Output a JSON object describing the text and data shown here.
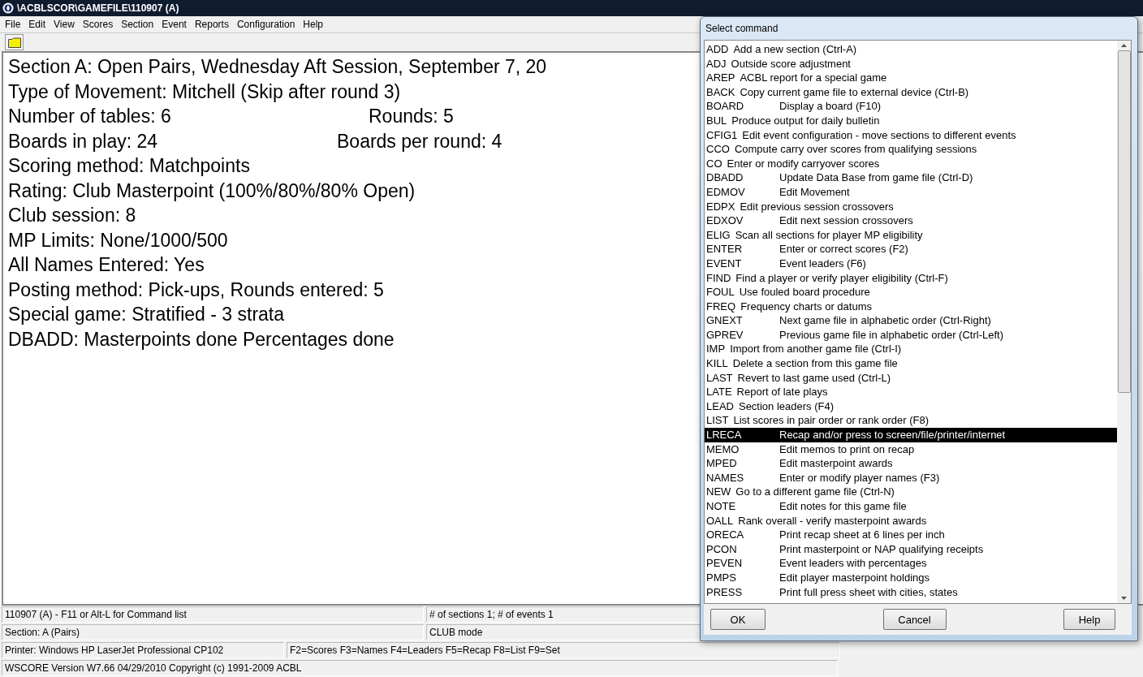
{
  "window": {
    "title": "\\ACBLSCOR\\GAMEFILE\\110907 (A)"
  },
  "menu": [
    "File",
    "Edit",
    "View",
    "Scores",
    "Section",
    "Event",
    "Reports",
    "Configuration",
    "Help"
  ],
  "summary_lines": [
    "Section A: Open Pairs, Wednesday Aft Session, September 7, 20",
    "Type of Movement: Mitchell (Skip after round 3)",
    [
      "Number of tables: 6",
      "Rounds: 5"
    ],
    [
      "Boards in play: 24",
      "Boards per round: 4"
    ],
    "Scoring method: Matchpoints",
    "Rating: Club Masterpoint (100%/80%/80% Open)",
    "Club session: 8",
    "MP Limits: None/1000/500",
    "All Names Entered: Yes",
    "Posting method: Pick-ups, Rounds entered: 5",
    "Special game:  Stratified - 3 strata",
    "DBADD: Masterpoints done  Percentages done"
  ],
  "status_bar": [
    [
      "110907 (A)  -  F11 or Alt-L for Command list",
      "# of sections 1; # of events 1"
    ],
    [
      "Section: A (Pairs)",
      "CLUB mode"
    ],
    [
      "Printer: Windows HP LaserJet Professional CP102",
      "F2=Scores F3=Names F4=Leaders F5=Recap F8=List F9=Set"
    ],
    [
      "WSCORE Version W7.66 04/29/2010  Copyright (c) 1991-2009 ACBL"
    ]
  ],
  "dialog": {
    "title": "Select command",
    "buttons": [
      "OK",
      "Cancel",
      "Help"
    ],
    "commands": [
      {
        "code": "ADD",
        "description": "Add a new section (Ctrl-A)",
        "kind": "inline",
        "selected": false
      },
      {
        "code": "ADJ",
        "description": "Outside score adjustment",
        "kind": "inline",
        "selected": false
      },
      {
        "code": "AREP",
        "description": "ACBL report for a special game",
        "kind": "inline",
        "selected": false
      },
      {
        "code": "BACK",
        "description": "Copy current game file to external device (Ctrl-B)",
        "kind": "inline",
        "selected": false
      },
      {
        "code": "BOARD",
        "description": "Display a board (F10)",
        "kind": "tabbed",
        "selected": false
      },
      {
        "code": "BUL",
        "description": "Produce output for daily bulletin",
        "kind": "inline",
        "selected": false
      },
      {
        "code": "CFIG1",
        "description": "Edit event configuration - move sections to different events",
        "kind": "inline",
        "selected": false
      },
      {
        "code": "CCO",
        "description": "Compute carry over scores from qualifying sessions",
        "kind": "inline",
        "selected": false
      },
      {
        "code": "CO",
        "description": "Enter or modify carryover scores",
        "kind": "inline",
        "selected": false
      },
      {
        "code": "DBADD",
        "description": "Update Data Base from game file (Ctrl-D)",
        "kind": "tabbed",
        "selected": false
      },
      {
        "code": "EDMOV",
        "description": "Edit Movement",
        "kind": "tabbed",
        "selected": false
      },
      {
        "code": "EDPX",
        "description": "Edit previous session crossovers",
        "kind": "inline",
        "selected": false
      },
      {
        "code": "EDXOV",
        "description": "Edit next session crossovers",
        "kind": "tabbed",
        "selected": false
      },
      {
        "code": "ELIG",
        "description": "Scan all sections for player MP eligibility",
        "kind": "inline",
        "selected": false
      },
      {
        "code": "ENTER",
        "description": "Enter or correct scores (F2)",
        "kind": "tabbed",
        "selected": false
      },
      {
        "code": "EVENT",
        "description": "Event leaders (F6)",
        "kind": "tabbed",
        "selected": false
      },
      {
        "code": "FIND",
        "description": "Find a player or verify player eligibility (Ctrl-F)",
        "kind": "inline",
        "selected": false
      },
      {
        "code": "FOUL",
        "description": "Use fouled board procedure",
        "kind": "inline",
        "selected": false
      },
      {
        "code": "FREQ",
        "description": "Frequency charts or datums",
        "kind": "inline",
        "selected": false
      },
      {
        "code": "GNEXT",
        "description": "Next game file in alphabetic order (Ctrl-Right)",
        "kind": "tabbed",
        "selected": false
      },
      {
        "code": "GPREV",
        "description": "Previous game file in alphabetic order (Ctrl-Left)",
        "kind": "tabbed",
        "selected": false
      },
      {
        "code": "IMP",
        "description": "Import from another game file (Ctrl-I)",
        "kind": "inline",
        "selected": false
      },
      {
        "code": "KILL",
        "description": "Delete a section from this game file",
        "kind": "inline",
        "selected": false
      },
      {
        "code": "LAST",
        "description": "Revert to last game used (Ctrl-L)",
        "kind": "inline",
        "selected": false
      },
      {
        "code": "LATE",
        "description": "Report of late plays",
        "kind": "inline",
        "selected": false
      },
      {
        "code": "LEAD",
        "description": "Section leaders (F4)",
        "kind": "inline",
        "selected": false
      },
      {
        "code": "LIST",
        "description": "List scores in pair order or rank order (F8)",
        "kind": "inline",
        "selected": false
      },
      {
        "code": "LRECA",
        "description": "Recap and/or press to screen/file/printer/internet",
        "kind": "tabbed",
        "selected": true
      },
      {
        "code": "MEMO",
        "description": "Edit memos to print on recap",
        "kind": "tabbed",
        "selected": false
      },
      {
        "code": "MPED",
        "description": "Edit masterpoint awards",
        "kind": "tabbed",
        "selected": false
      },
      {
        "code": "NAMES",
        "description": "Enter or modify player names (F3)",
        "kind": "tabbed",
        "selected": false
      },
      {
        "code": "NEW",
        "description": "Go to a different game file (Ctrl-N)",
        "kind": "inline",
        "selected": false
      },
      {
        "code": "NOTE",
        "description": "Edit notes for this game file",
        "kind": "tabbed",
        "selected": false
      },
      {
        "code": "OALL",
        "description": "Rank overall - verify masterpoint awards",
        "kind": "inline",
        "selected": false
      },
      {
        "code": "ORECA",
        "description": "Print recap sheet at 6 lines per inch",
        "kind": "tabbed",
        "selected": false
      },
      {
        "code": "PCON",
        "description": "Print masterpoint or NAP qualifying receipts",
        "kind": "tabbed",
        "selected": false
      },
      {
        "code": "PEVEN",
        "description": "Event leaders with percentages",
        "kind": "tabbed",
        "selected": false
      },
      {
        "code": "PMPS",
        "description": "Edit player masterpoint holdings",
        "kind": "tabbed",
        "selected": false
      },
      {
        "code": "PRESS",
        "description": "Print full press sheet with cities, states",
        "kind": "tabbed",
        "selected": false
      }
    ]
  }
}
